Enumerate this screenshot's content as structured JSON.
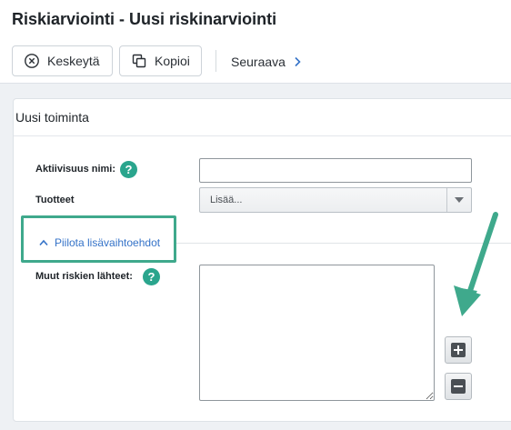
{
  "header": {
    "title": "Riskiarviointi - Uusi riskinarviointi",
    "cancel_label": "Keskeytä",
    "copy_label": "Kopioi",
    "next_label": "Seuraava"
  },
  "panel": {
    "title": "Uusi toiminta"
  },
  "form": {
    "activity_name_label": "Aktiivisuus nimi:",
    "activity_name_value": "",
    "products_label": "Tuotteet",
    "products_placeholder": "Lisää...",
    "toggle_label": "Piilota lisävaihtoehdot",
    "sources_label": "Muut riskien lähteet:",
    "sources_value": "",
    "help_glyph": "?"
  },
  "icons": {
    "cancel": "circle-x-icon",
    "copy": "copy-icon",
    "next": "chevron-right-icon",
    "toggle": "chevron-up-icon",
    "add": "plus-square-icon",
    "remove": "minus-square-icon",
    "annotation": "annotation-arrow-icon"
  },
  "colors": {
    "accent": "#2aa58d",
    "annotation": "#3fa98c",
    "link": "#3573c8"
  }
}
